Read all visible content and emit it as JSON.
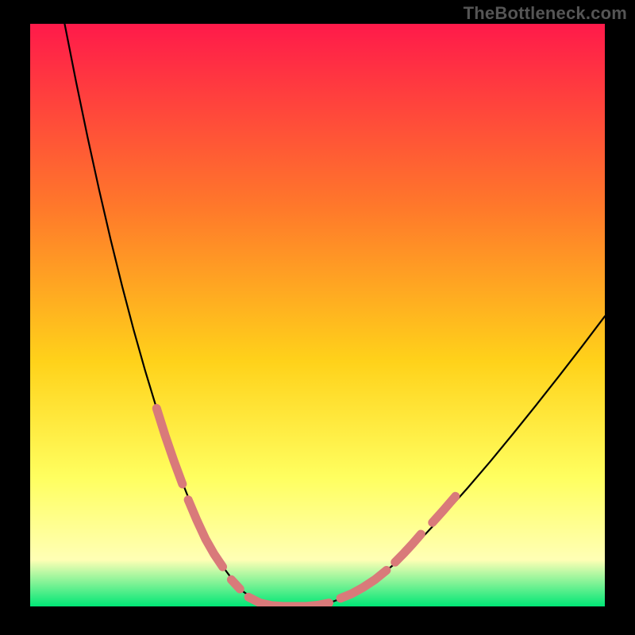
{
  "watermark": "TheBottleneck.com",
  "colors": {
    "background": "#000000",
    "gradient_top": "#ff1a4a",
    "gradient_upper_mid": "#ff7a2a",
    "gradient_mid": "#ffd21a",
    "gradient_lower_mid": "#ffff60",
    "gradient_near_bottom": "#ffffb5",
    "gradient_bottom": "#00e676",
    "curve": "#000000",
    "markers": "#d97a7a"
  },
  "chart_data": {
    "type": "line",
    "title": "",
    "xlabel": "",
    "ylabel": "",
    "xlim": [
      0,
      100
    ],
    "ylim": [
      0,
      100
    ],
    "curve": {
      "x": [
        6,
        8,
        10,
        12,
        14,
        16,
        18,
        20,
        22,
        24,
        26,
        28,
        29.5,
        31,
        32.5,
        34,
        35.5,
        37,
        39,
        41,
        44,
        48,
        52,
        56,
        60,
        64,
        68,
        72,
        76,
        80,
        84,
        88,
        92,
        96,
        100
      ],
      "y": [
        100,
        90,
        80.5,
        71.5,
        63,
        55,
        47.5,
        40.5,
        34,
        28,
        22.5,
        17.5,
        14,
        11,
        8.5,
        6.2,
        4.2,
        2.6,
        1.2,
        0.35,
        0.02,
        0.02,
        0.6,
        2.0,
        4.5,
        7.8,
        11.6,
        15.8,
        20.2,
        24.8,
        29.6,
        34.5,
        39.5,
        44.6,
        49.8
      ]
    },
    "marker_segments": [
      {
        "side": "left",
        "x": [
          22.0,
          23.5,
          25.0,
          26.5
        ],
        "y": [
          34.0,
          29.3,
          25.0,
          21.0
        ]
      },
      {
        "side": "left",
        "x": [
          27.5,
          29.0,
          30.5,
          32.0,
          33.5
        ],
        "y": [
          18.3,
          14.8,
          11.6,
          9.0,
          6.8
        ]
      },
      {
        "side": "left",
        "x": [
          35.0,
          36.5
        ],
        "y": [
          4.6,
          3.0
        ]
      },
      {
        "side": "floor",
        "x": [
          38.0,
          40.0,
          42.0,
          44.0,
          46.0,
          48.0,
          50.0,
          52.0
        ],
        "y": [
          1.6,
          0.6,
          0.15,
          0.02,
          0.02,
          0.02,
          0.2,
          0.6
        ]
      },
      {
        "side": "right",
        "x": [
          54.0,
          56.0,
          58.0,
          60.0,
          62.0
        ],
        "y": [
          1.4,
          2.2,
          3.3,
          4.6,
          6.2
        ]
      },
      {
        "side": "right",
        "x": [
          63.5,
          65.0,
          66.5,
          68.0
        ],
        "y": [
          7.6,
          9.1,
          10.7,
          12.4
        ]
      },
      {
        "side": "right",
        "x": [
          70.0,
          72.0,
          74.0
        ],
        "y": [
          14.4,
          16.6,
          18.9
        ]
      }
    ]
  }
}
